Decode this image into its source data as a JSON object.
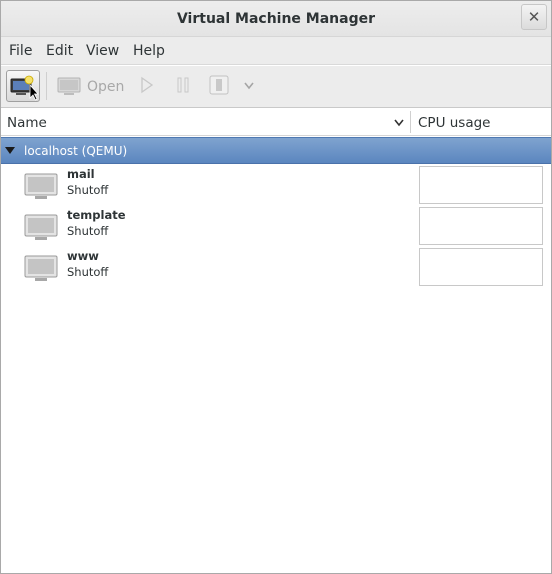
{
  "window": {
    "title": "Virtual Machine Manager",
    "close_glyph": "✕"
  },
  "menu": {
    "items": [
      "File",
      "Edit",
      "View",
      "Help"
    ]
  },
  "toolbar": {
    "new_icon": "new-vm-icon",
    "open_label": "Open",
    "run_icon": "play-icon",
    "pause_icon": "pause-icon",
    "shutdown_icon": "shutdown-icon",
    "menu_icon": "chevron-down-icon"
  },
  "columns": {
    "name": "Name",
    "cpu": "CPU usage"
  },
  "connection": {
    "label": "localhost (QEMU)"
  },
  "vms": [
    {
      "name": "mail",
      "state": "Shutoff"
    },
    {
      "name": "template",
      "state": "Shutoff"
    },
    {
      "name": "www",
      "state": "Shutoff"
    }
  ],
  "colors": {
    "selection": "#5b86bf",
    "window_bg": "#ececec"
  }
}
